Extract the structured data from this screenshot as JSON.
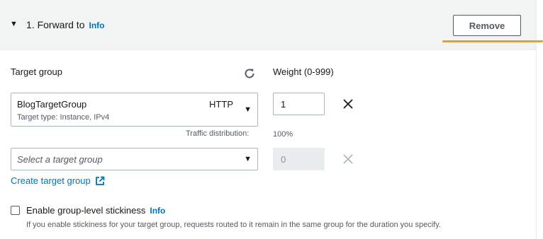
{
  "header": {
    "title": "1. Forward to",
    "info": "Info",
    "remove_label": "Remove"
  },
  "target_group": {
    "label": "Target group",
    "weight_label": "Weight (0-999)",
    "rows": [
      {
        "name": "BlogTargetGroup",
        "subtitle": "Target type: Instance, IPv4",
        "protocol": "HTTP",
        "weight": "1",
        "distribution_label": "Traffic distribution:",
        "distribution_value": "100%"
      },
      {
        "placeholder": "Select a target group",
        "weight": "0"
      }
    ],
    "create_link": "Create target group"
  },
  "stickiness": {
    "label": "Enable group-level stickiness",
    "info": "Info",
    "description": "If you enable stickiness for your target group, requests routed to it remain in the same group for the duration you specify.",
    "checked": false
  },
  "colors": {
    "link": "#0073bb",
    "highlight": "#f4a100",
    "header_bg": "#f2f3f3"
  }
}
